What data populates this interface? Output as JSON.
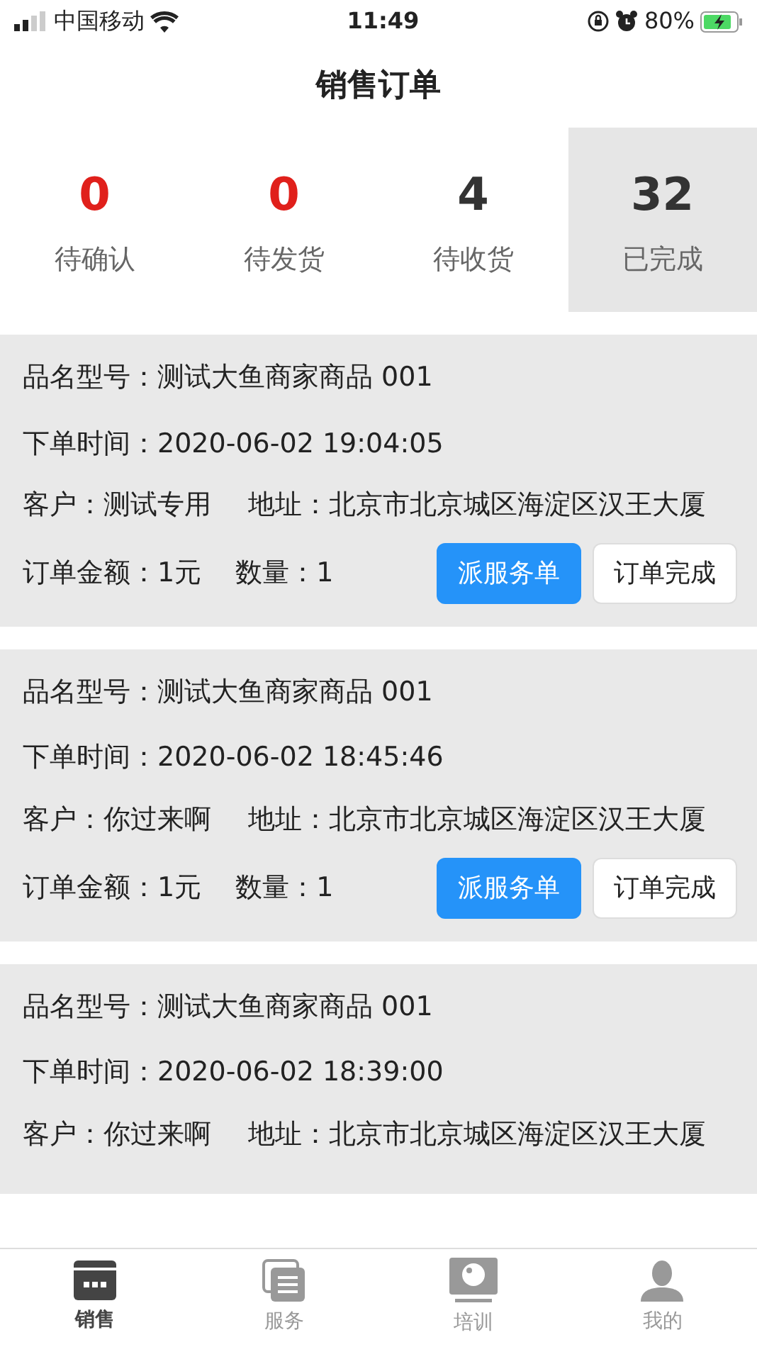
{
  "status_bar": {
    "carrier": "中国移动",
    "time": "11:49",
    "battery": "80%"
  },
  "title": "销售订单",
  "stats": [
    {
      "count": "0",
      "label": "待确认",
      "color": "#e0201b",
      "selected": false
    },
    {
      "count": "0",
      "label": "待发货",
      "color": "#e0201b",
      "selected": false
    },
    {
      "count": "4",
      "label": "待收货",
      "color": "#333333",
      "selected": false
    },
    {
      "count": "32",
      "label": "已完成",
      "color": "#333333",
      "selected": true
    }
  ],
  "orders": [
    {
      "product": "品名型号：测试大鱼商家商品 001",
      "time": "下单时间：2020-06-02 19:04:05",
      "customer": "客户：测试专用",
      "address": "地址：北京市北京城区海淀区汉王大厦",
      "amount": "订单金额：1元",
      "quantity": "数量：1",
      "buttons": [
        {
          "label": "派服务单",
          "kind": "primary"
        },
        {
          "label": "订单完成",
          "kind": "outline"
        }
      ]
    },
    {
      "product": "品名型号：测试大鱼商家商品 001",
      "time": "下单时间：2020-06-02 18:45:46",
      "customer": "客户：你过来啊",
      "address": "地址：北京市北京城区海淀区汉王大厦",
      "amount": "订单金额：1元",
      "quantity": "数量：1",
      "buttons": [
        {
          "label": "派服务单",
          "kind": "primary"
        },
        {
          "label": "订单完成",
          "kind": "outline"
        }
      ]
    },
    {
      "product": "品名型号：测试大鱼商家商品 001",
      "time": "下单时间：2020-06-02 18:39:00",
      "customer": "客户：你过来啊",
      "address": "地址：北京市北京城区海淀区汉王大厦"
    }
  ],
  "tab_bar": [
    {
      "label": "销售",
      "kind": "sales",
      "selected": true
    },
    {
      "label": "服务",
      "kind": "service",
      "selected": false
    },
    {
      "label": "培训",
      "kind": "training",
      "selected": false
    },
    {
      "label": "我的",
      "kind": "me",
      "selected": false
    }
  ]
}
